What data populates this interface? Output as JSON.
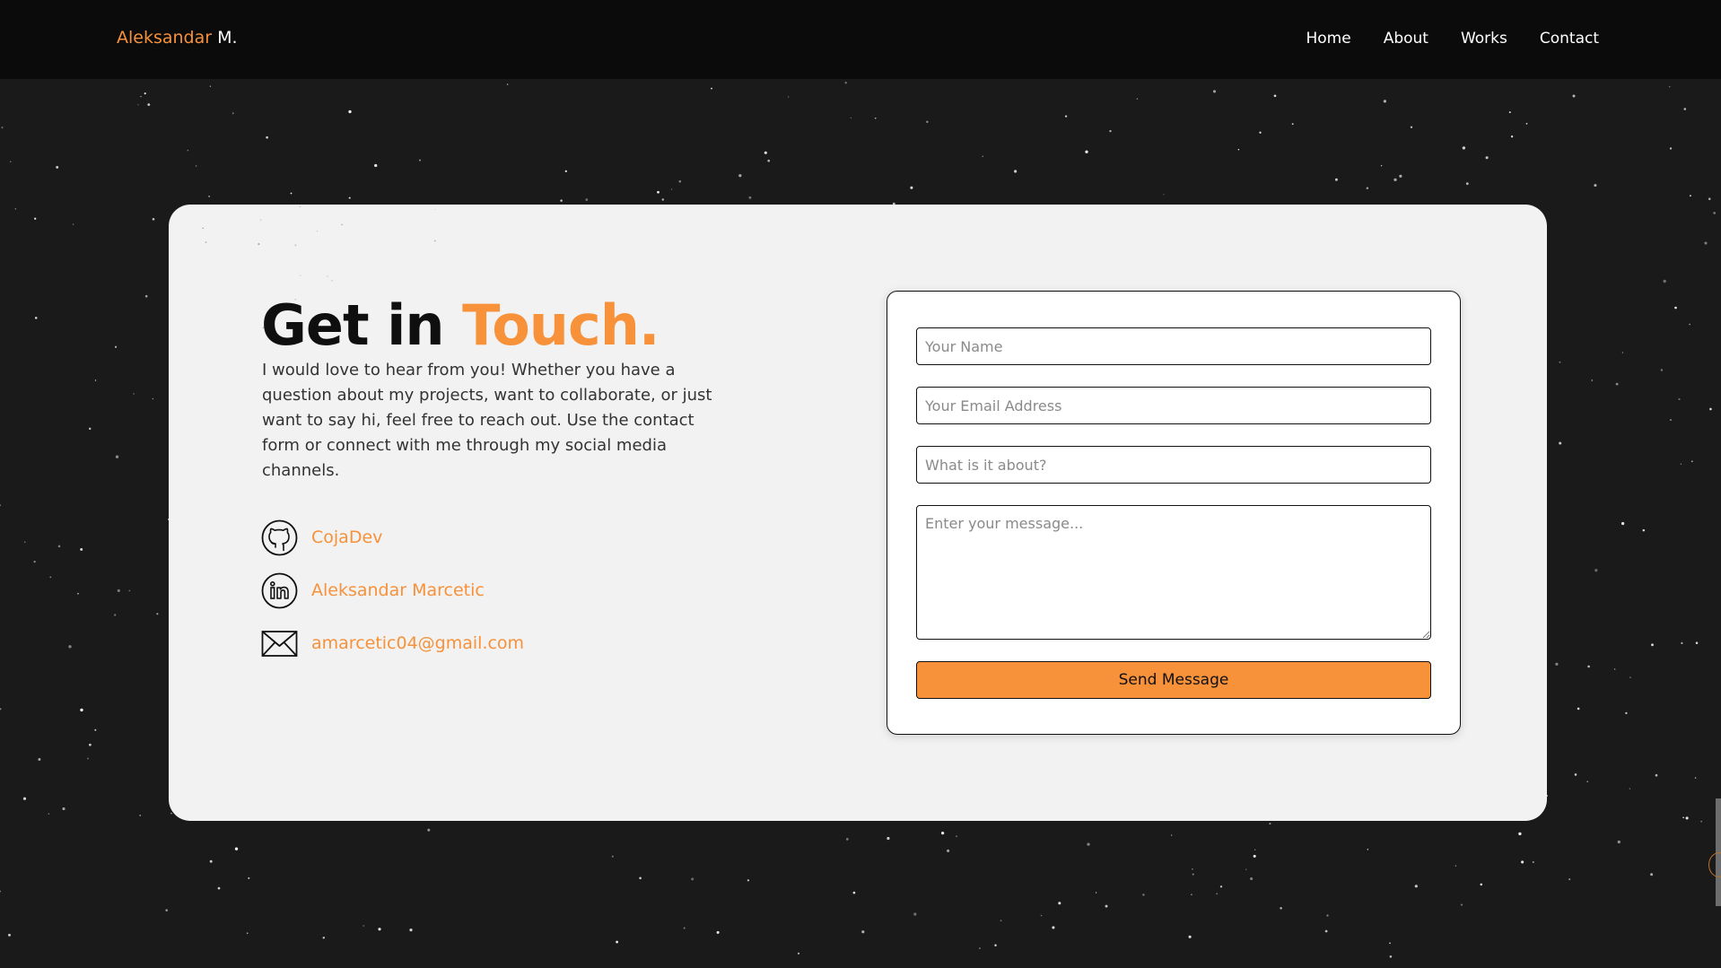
{
  "brand": {
    "first": "Aleksandar",
    "last": "M."
  },
  "nav": {
    "items": [
      "Home",
      "About",
      "Works",
      "Contact"
    ]
  },
  "contact": {
    "heading_plain": "Get in",
    "heading_accent": "Touch.",
    "intro": "I would love to hear from you! Whether you have a question about my projects, want to collaborate, or just want to say hi, feel free to reach out. Use the contact form or connect with me through my social media channels.",
    "socials": [
      {
        "icon": "github-icon",
        "label": "CojaDev"
      },
      {
        "icon": "linkedin-icon",
        "label": "Aleksandar Marcetic"
      },
      {
        "icon": "mail-icon",
        "label": "amarcetic04@gmail.com"
      }
    ]
  },
  "form": {
    "name_placeholder": "Your Name",
    "email_placeholder": "Your Email Address",
    "subject_placeholder": "What is it about?",
    "message_placeholder": "Enter your message...",
    "submit_label": "Send Message"
  },
  "colors": {
    "accent": "#f7913a",
    "background": "#1a1a1a",
    "navbar": "#0b0b0b",
    "card": "#f2f2f2"
  }
}
